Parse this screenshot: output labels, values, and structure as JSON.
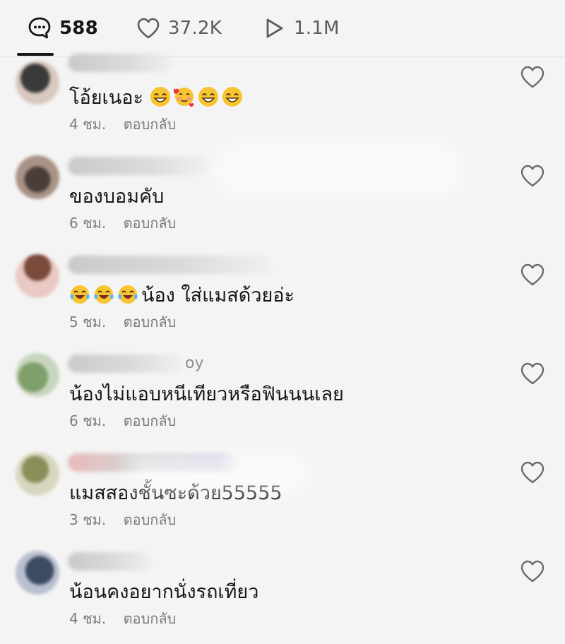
{
  "stats": {
    "comments": "588",
    "likes": "37.2K",
    "views": "1.1M"
  },
  "comments": [
    {
      "text": "โอ้ยเนอะ",
      "emojis_after": [
        "grinning-face",
        "smiling-face-with-hearts",
        "grinning-face",
        "grinning-face"
      ],
      "time": "4 ชม.",
      "reply": "ตอบกลับ",
      "avatar_colors": [
        "#2b2b2b",
        "#d8c8bf"
      ]
    },
    {
      "text": "ของบอมคับ",
      "emojis_after": [],
      "time": "6 ชม.",
      "reply": "ตอบกลับ",
      "avatar_colors": [
        "#4a3d38",
        "#a89386"
      ]
    },
    {
      "text": "น้อง ใส่แมสด้วยอ่ะ",
      "emojis_before": [
        "tears-of-joy",
        "tears-of-joy",
        "tears-of-joy"
      ],
      "time": "5 ชม.",
      "reply": "ตอบกลับ",
      "avatar_colors": [
        "#7a4a3a",
        "#e9c9c4"
      ]
    },
    {
      "username_tail": "oy",
      "text": "น้องไม่แอบหนีเทียวหรือฟินนนเลย",
      "time": "6 ชม.",
      "reply": "ตอบกลับ",
      "avatar_colors": [
        "#7fa06a",
        "#c8d6c0"
      ]
    },
    {
      "text": "แมสสองชั้นซะด้วย55555",
      "time": "3 ชม.",
      "reply": "ตอบกลับ",
      "avatar_colors": [
        "#8a8f5a",
        "#d9d6c0"
      ]
    },
    {
      "text": "น้อนคงอยากนั่งรถเที่ยว",
      "time": "4 ชม.",
      "reply": "ตอบกลับ",
      "avatar_colors": [
        "#3d4a63",
        "#b9c0cf"
      ]
    }
  ]
}
